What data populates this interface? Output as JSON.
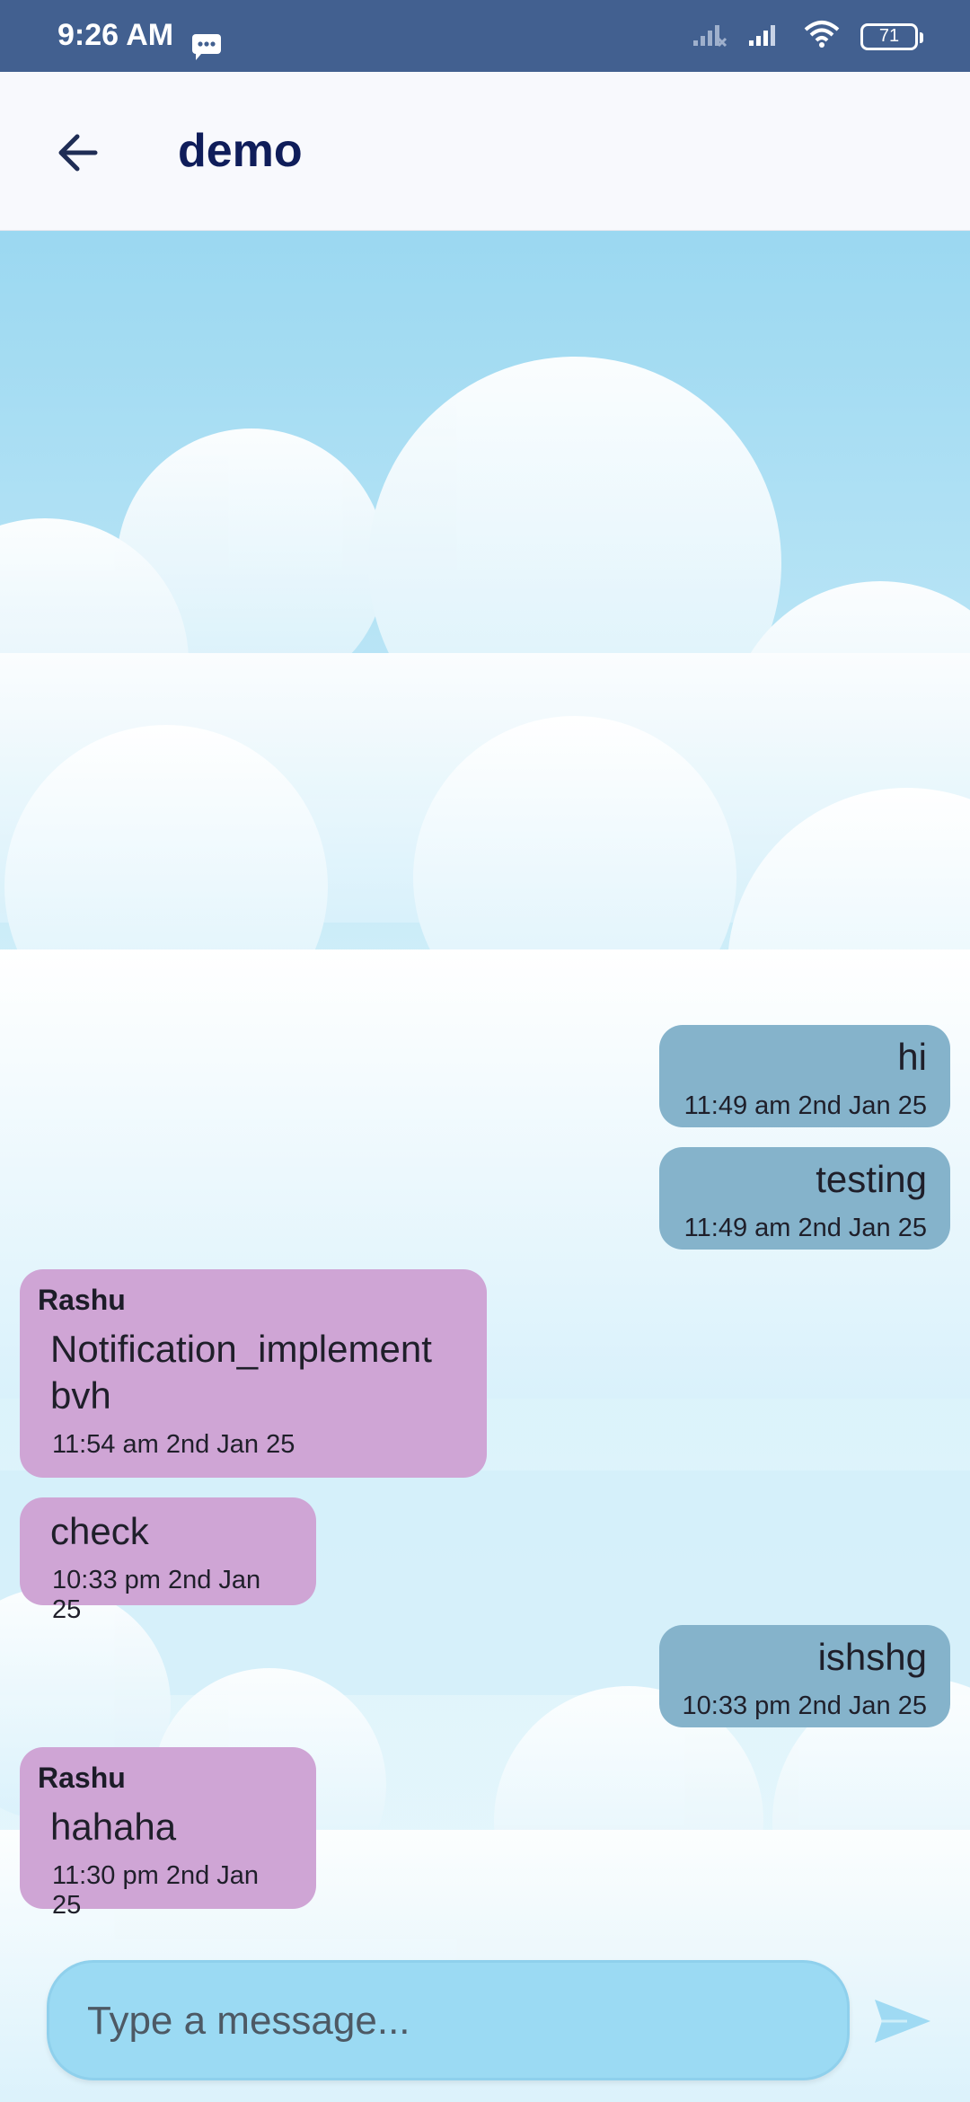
{
  "status_bar": {
    "time": "9:26 AM",
    "battery": "71",
    "icons": [
      "message-icon",
      "signal-off-icon",
      "signal-icon",
      "wifi-icon",
      "battery-icon"
    ]
  },
  "app_bar": {
    "title": "demo",
    "back_icon": "arrow-left-icon"
  },
  "messages": [
    {
      "direction": "out",
      "text": "hi",
      "time": "11:49 am 2nd Jan 25"
    },
    {
      "direction": "out",
      "text": "testing",
      "time": "11:49 am 2nd Jan 25"
    },
    {
      "direction": "in",
      "sender": "Rashu",
      "text": "Notification_implement\nbvh",
      "time": "11:54 am 2nd Jan 25"
    },
    {
      "direction": "in",
      "text": "check",
      "time": "10:33 pm 2nd Jan 25"
    },
    {
      "direction": "out",
      "text": "ishshg",
      "time": "10:33 pm 2nd Jan 25"
    },
    {
      "direction": "in",
      "sender": "Rashu",
      "text": "hahaha",
      "time": "11:30 pm 2nd Jan 25"
    }
  ],
  "composer": {
    "placeholder": "Type a message...",
    "value": "",
    "send_icon": "send-icon"
  },
  "colors": {
    "status_bar": "#426090",
    "outgoing_bubble": "#85b3cb",
    "incoming_bubble": "#cfa5d5",
    "composer": "#9bdaf3",
    "title": "#0f1d5a"
  }
}
